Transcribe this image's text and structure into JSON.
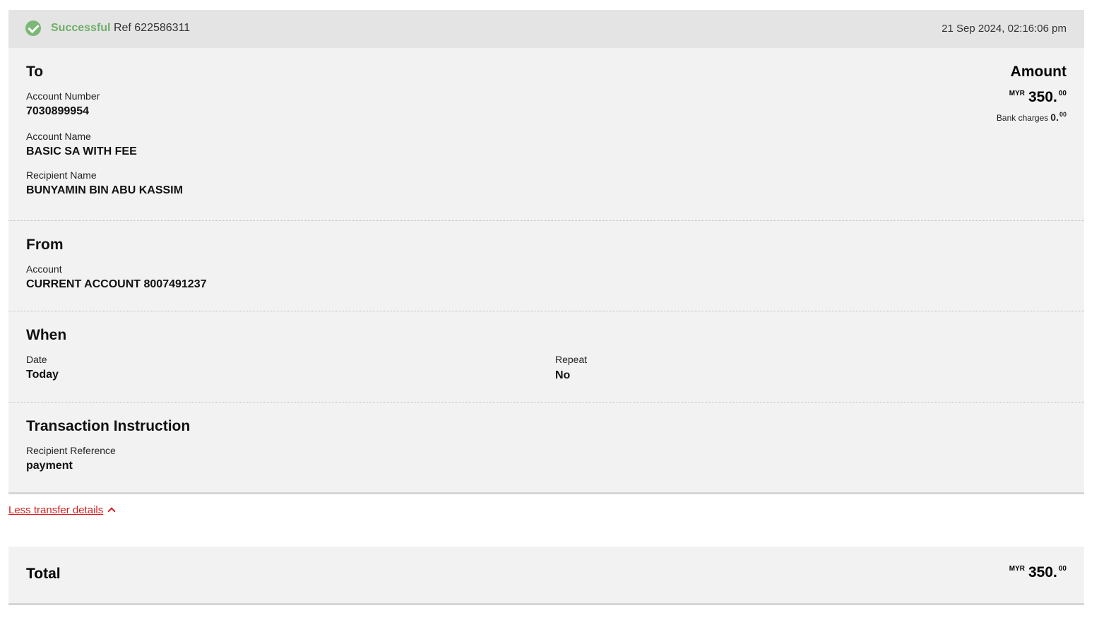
{
  "status": {
    "icon": "check-circle-icon",
    "status_text": "Successful",
    "ref_text": "Ref 622586311",
    "timestamp": "21 Sep 2024, 02:16:06 pm",
    "status_color": "#6fae6a"
  },
  "to_section": {
    "title": "To",
    "account_number_label": "Account Number",
    "account_number": "7030899954",
    "account_name_label": "Account Name",
    "account_name": "BASIC SA WITH FEE",
    "recipient_name_label": "Recipient Name",
    "recipient_name": "BUNYAMIN BIN ABU KASSIM"
  },
  "amount": {
    "title": "Amount",
    "currency": "MYR",
    "whole": "350.",
    "cents": "00",
    "bank_charges_label": "Bank charges",
    "bank_charges_whole": "0.",
    "bank_charges_cents": "00"
  },
  "from_section": {
    "title": "From",
    "account_label": "Account",
    "account_value": "CURRENT ACCOUNT 8007491237"
  },
  "when_section": {
    "title": "When",
    "date_label": "Date",
    "date_value": "Today",
    "repeat_label": "Repeat",
    "repeat_value": "No"
  },
  "instruction_section": {
    "title": "Transaction Instruction",
    "reference_label": "Recipient Reference",
    "reference_value": "payment"
  },
  "toggle": {
    "label": "Less transfer details",
    "icon": "chevron-up-icon",
    "link_color": "#d11f1f"
  },
  "total": {
    "title": "Total",
    "currency": "MYR",
    "whole": "350.",
    "cents": "00"
  }
}
